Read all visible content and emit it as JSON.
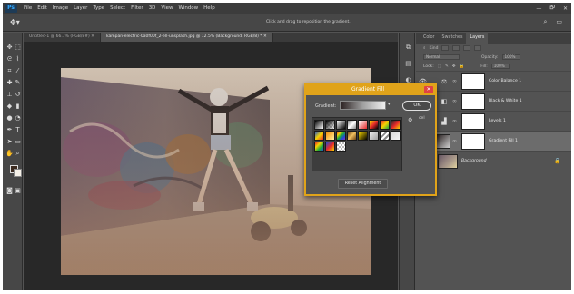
{
  "app": {
    "logo": "Ps",
    "menu": [
      "File",
      "Edit",
      "Image",
      "Layer",
      "Type",
      "Select",
      "Filter",
      "3D",
      "View",
      "Window",
      "Help"
    ],
    "window_controls": [
      "—",
      "🗗",
      "✕"
    ]
  },
  "options_bar": {
    "hint": "Click and drag to reposition the gradient."
  },
  "document": {
    "tabs": [
      {
        "label": "Untitled-1 @ 66.7% (RGB/8#)",
        "active": false
      },
      {
        "label": "kampan-electric-0a0f00f_2-ell-unsplash.jpg @ 12.5% (Background, RGB/8) *",
        "active": true
      }
    ]
  },
  "layers_panel": {
    "tabs": [
      {
        "label": "Color",
        "active": false
      },
      {
        "label": "Swatches",
        "active": false
      },
      {
        "label": "Layers",
        "active": true
      }
    ],
    "kind_label": "Kind",
    "blend_mode": "Normal",
    "opacity_label": "Opacity:",
    "opacity_value": "100%",
    "lock_label": "Lock:",
    "fill_label": "Fill:",
    "fill_value": "100%",
    "layers": [
      {
        "name": "Color Balance 1",
        "adj_icon": "balance-icon",
        "selected": false,
        "italic": false
      },
      {
        "name": "Black & White 1",
        "adj_icon": "bw-icon",
        "selected": false,
        "italic": false
      },
      {
        "name": "Levels 1",
        "adj_icon": "levels-icon",
        "selected": false,
        "italic": false
      },
      {
        "name": "Gradient Fill 1",
        "adj_icon": "gradient-icon",
        "selected": true,
        "italic": false
      },
      {
        "name": "Background",
        "adj_icon": "",
        "selected": false,
        "italic": true
      }
    ]
  },
  "gradient_dialog": {
    "title": "Gradient Fill",
    "close_label": "✕",
    "gradient_label": "Gradient:",
    "ok_label": "OK",
    "cancel_partial": "cel",
    "reset_label": "Reset Alignment",
    "colors": {
      "accent": "#e0a31a",
      "close": "#e04343"
    }
  }
}
